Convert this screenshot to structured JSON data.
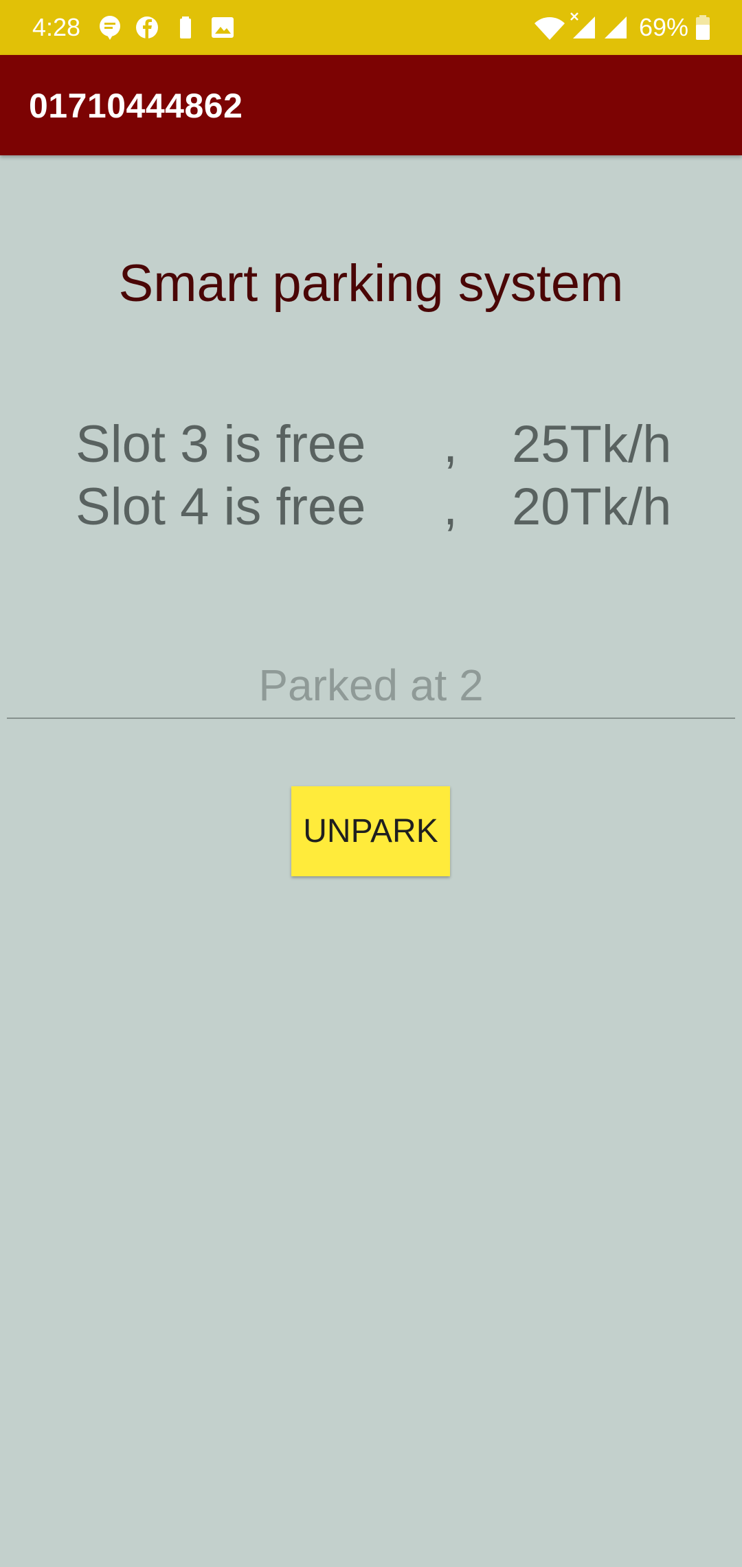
{
  "status_bar": {
    "time": "4:28",
    "battery_percent": "69%",
    "icons": [
      "message-icon",
      "facebook-icon",
      "battery-saver-icon",
      "image-icon",
      "wifi-icon",
      "signal-icon",
      "signal-icon",
      "battery-icon"
    ],
    "background_color": "#e1c107"
  },
  "app_bar": {
    "title": "01710444862",
    "background_color": "#7c0303"
  },
  "main": {
    "title": "Smart parking system",
    "slots": [
      {
        "name": "Slot 3 is free",
        "separator": ",",
        "price": "25Tk/h"
      },
      {
        "name": "Slot 4 is free",
        "separator": ",",
        "price": "20Tk/h"
      }
    ],
    "parked_field": {
      "placeholder": "Parked at 2",
      "value": ""
    },
    "unpark_button": {
      "label": "UNPARK",
      "color": "#ffeb3b"
    }
  },
  "colors": {
    "background": "#c3d0cc",
    "title_text": "#4a0606",
    "slot_text": "#596260"
  }
}
